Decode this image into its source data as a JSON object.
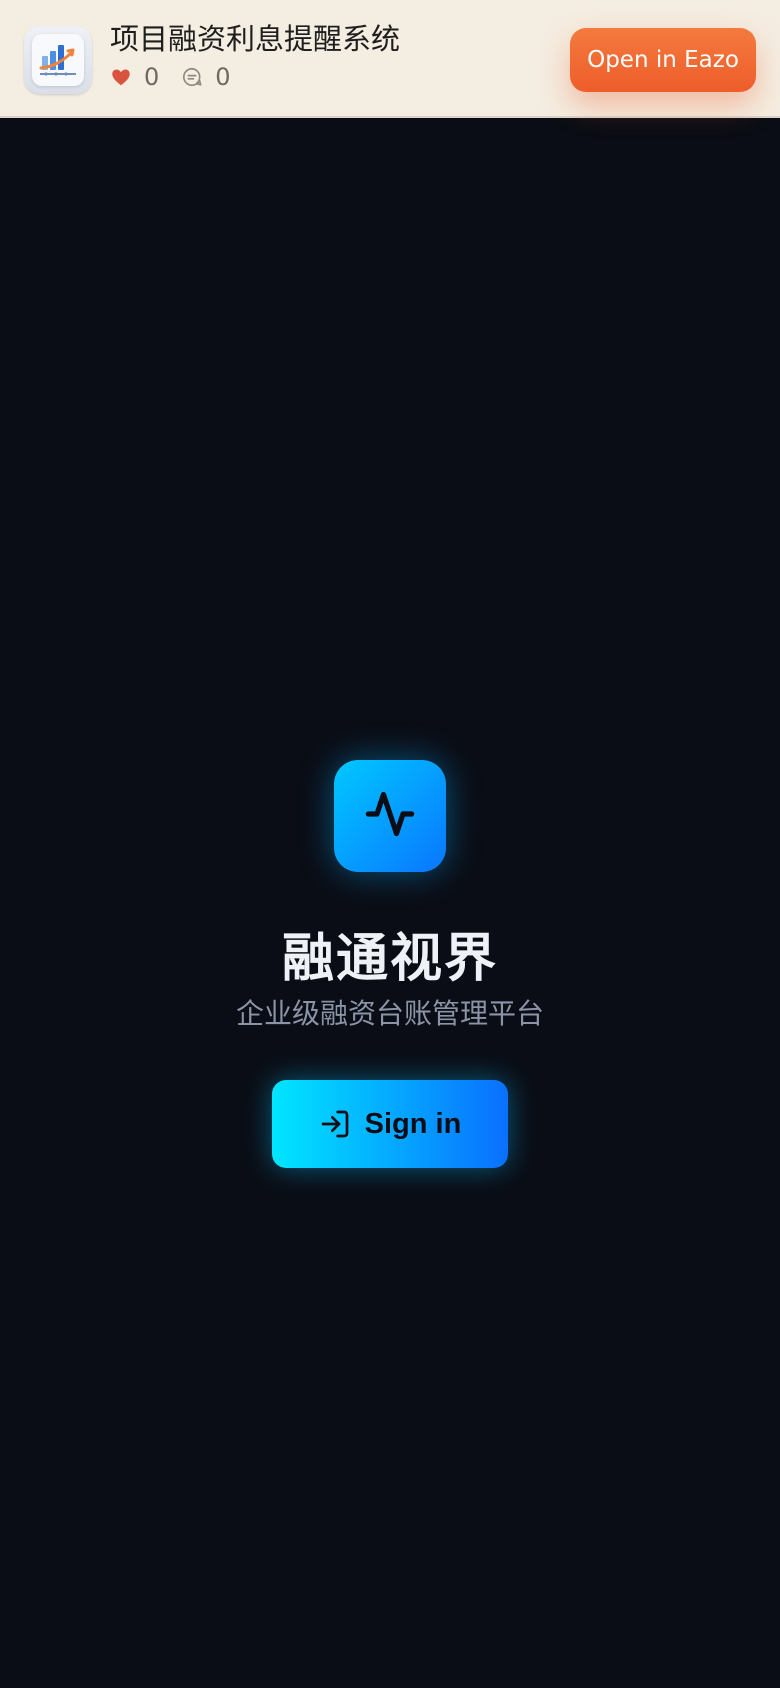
{
  "banner": {
    "app_title": "项目融资利息提醒系统",
    "likes_count": "0",
    "comments_count": "0",
    "open_button_label": "Open in Eazo",
    "app_icon": "chart-growth-icon",
    "like_icon": "heart-icon",
    "comment_icon": "chat-bubble-icon"
  },
  "main": {
    "logo_icon": "activity-pulse-icon",
    "title": "融通视界",
    "subtitle": "企业级融资台账管理平台",
    "signin_label": "Sign in",
    "signin_icon": "sign-in-arrow-icon"
  },
  "colors": {
    "background": "#0a0d15",
    "banner_background": "#f4ede1",
    "open_button": "#ef6530",
    "accent_start": "#00e6ff",
    "accent_end": "#0a6fff",
    "like_red": "#d9533f"
  }
}
